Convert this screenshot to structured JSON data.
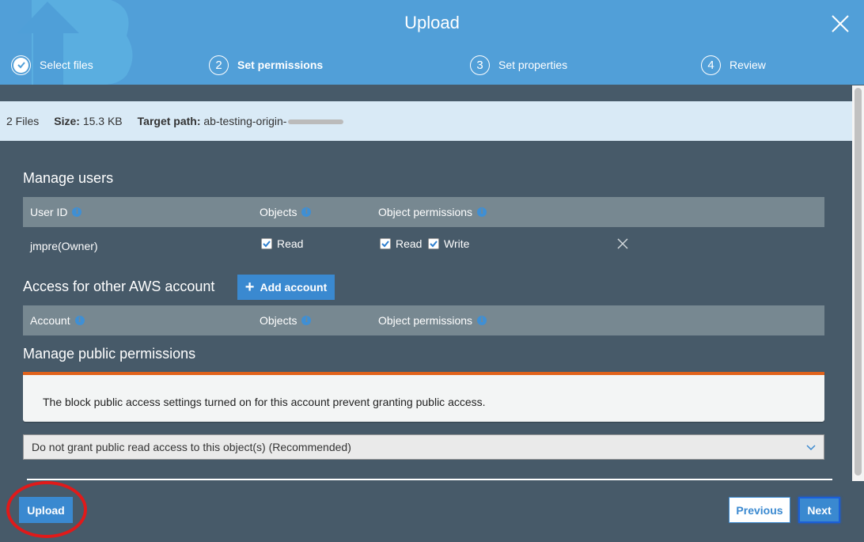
{
  "header": {
    "title": "Upload",
    "steps": [
      {
        "number": "1",
        "label": "Select files",
        "state": "done"
      },
      {
        "number": "2",
        "label": "Set permissions",
        "state": "active"
      },
      {
        "number": "3",
        "label": "Set properties",
        "state": "pending"
      },
      {
        "number": "4",
        "label": "Review",
        "state": "pending"
      }
    ]
  },
  "infobar": {
    "files": "2 Files",
    "size_label": "Size:",
    "size_value": "15.3 KB",
    "target_label": "Target path:",
    "target_value": "ab-testing-origin-"
  },
  "manage_users": {
    "title": "Manage users",
    "columns": [
      "User ID",
      "Objects",
      "Object permissions"
    ],
    "rows": [
      {
        "user_id": "jmpre(Owner)",
        "objects": [
          {
            "label": "Read",
            "checked": true
          }
        ],
        "object_permissions": [
          {
            "label": "Read",
            "checked": true
          },
          {
            "label": "Write",
            "checked": true
          }
        ]
      }
    ]
  },
  "other_accounts": {
    "title": "Access for other AWS account",
    "add_button": "Add account",
    "columns": [
      "Account",
      "Objects",
      "Object permissions"
    ]
  },
  "public_permissions": {
    "title": "Manage public permissions",
    "alert": "The block public access settings turned on for this account prevent granting public access.",
    "select_value": "Do not grant public read access to this object(s) (Recommended)"
  },
  "footer": {
    "upload": "Upload",
    "previous": "Previous",
    "next": "Next"
  },
  "colors": {
    "header": "#519fd8",
    "body": "#475a69",
    "accent": "#3a89d0",
    "alert_border": "#e0621b",
    "annotation": "#e01a1a"
  }
}
